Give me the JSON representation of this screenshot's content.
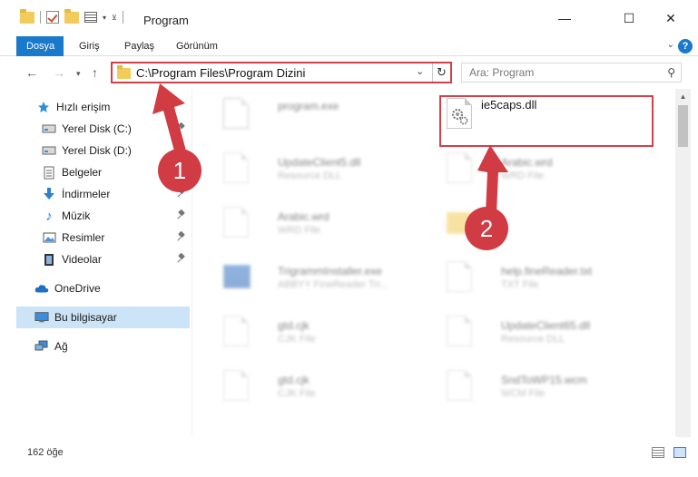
{
  "window": {
    "title": "Program",
    "controls": {
      "minimize": "—",
      "maximize": "☐",
      "close": "✕"
    }
  },
  "ribbon": {
    "tabs": [
      "Dosya",
      "Giriş",
      "Paylaş",
      "Görünüm"
    ],
    "active_tab": "Dosya",
    "help": "?"
  },
  "nav": {
    "address": "C:\\Program Files\\Program Dizini",
    "search_placeholder": "Ara: Program"
  },
  "sidebar": {
    "items": [
      {
        "label": "Hızlı erişim",
        "icon": "star-icon"
      },
      {
        "label": "Yerel Disk (C:)",
        "icon": "drive-icon",
        "pinned": true
      },
      {
        "label": "Yerel Disk (D:)",
        "icon": "drive-icon",
        "pinned": true
      },
      {
        "label": "Belgeler",
        "icon": "documents-icon",
        "pinned": true
      },
      {
        "label": "İndirmeler",
        "icon": "download-icon",
        "pinned": true
      },
      {
        "label": "Müzik",
        "icon": "music-icon",
        "pinned": true
      },
      {
        "label": "Resimler",
        "icon": "pictures-icon",
        "pinned": true
      },
      {
        "label": "Videolar",
        "icon": "videos-icon",
        "pinned": true
      },
      {
        "label": "OneDrive",
        "icon": "onedrive-icon"
      },
      {
        "label": "Bu bilgisayar",
        "icon": "computer-icon",
        "selected": true
      },
      {
        "label": "Ağ",
        "icon": "network-icon"
      }
    ]
  },
  "files": [
    {
      "name": "program.exe",
      "type": "",
      "icon": "exe-icon"
    },
    {
      "name": "ie5caps.dll",
      "type": "",
      "icon": "dll-icon"
    },
    {
      "name": "UpdateClient5.dll",
      "type": "Resource DLL",
      "icon": "dll-icon"
    },
    {
      "name": "Arabic.wrd",
      "type": "WRD File",
      "icon": "file-icon"
    },
    {
      "name": "Arabic.wrd",
      "type": "WRD File",
      "icon": "file-icon"
    },
    {
      "name": "",
      "type": "",
      "icon": "folder-icon"
    },
    {
      "name": "TrigrammInstaller.exe",
      "type": "ABBYY FineReader Tri...",
      "icon": "exe-icon"
    },
    {
      "name": "help.fineReader.txt",
      "type": "TXT File",
      "icon": "file-icon"
    },
    {
      "name": "gtd.cjk",
      "type": "CJK File",
      "icon": "file-icon"
    },
    {
      "name": "UpdateClient65.dll",
      "type": "Resource DLL",
      "icon": "dll-icon"
    },
    {
      "name": "gtd.cjk",
      "type": "CJK File",
      "icon": "file-icon"
    },
    {
      "name": "SndToWP15.wcm",
      "type": "WCM File",
      "icon": "file-icon"
    }
  ],
  "annotations": [
    "1",
    "2"
  ],
  "status": {
    "item_count": "162 öğe"
  },
  "colors": {
    "accent": "#1979ca",
    "highlight": "#d43f4a",
    "selection": "#cce4f7"
  }
}
